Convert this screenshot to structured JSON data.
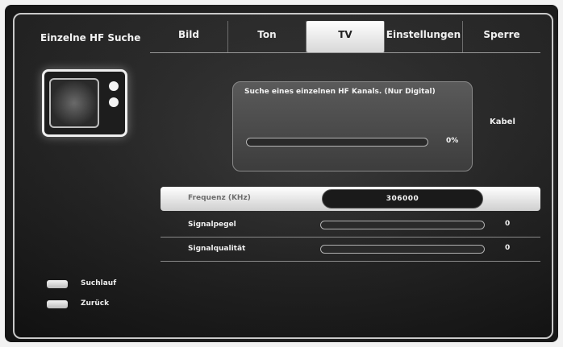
{
  "header": {
    "title": "Einzelne HF Suche"
  },
  "tabs": [
    {
      "label": "Bild",
      "active": false
    },
    {
      "label": "Ton",
      "active": false
    },
    {
      "label": "TV",
      "active": true
    },
    {
      "label": "Einstellungen",
      "active": false
    },
    {
      "label": "Sperre",
      "active": false
    }
  ],
  "search": {
    "title": "Suche eines einzelnen HF Kanals. (Nur Digital)",
    "progress_label": "0%",
    "progress": 0
  },
  "source": {
    "label": "Kabel"
  },
  "fields": {
    "frequency": {
      "label": "Frequenz (KHz)",
      "value": "306000"
    },
    "signal_level": {
      "label": "Signalpegel",
      "value": "0",
      "level": 0
    },
    "signal_quality": {
      "label": "Signalqualität",
      "value": "0",
      "level": 0
    }
  },
  "legend": [
    {
      "key": "search-key-icon",
      "label": "Suchlauf"
    },
    {
      "key": "back-key-icon",
      "label": "Zurück"
    }
  ]
}
